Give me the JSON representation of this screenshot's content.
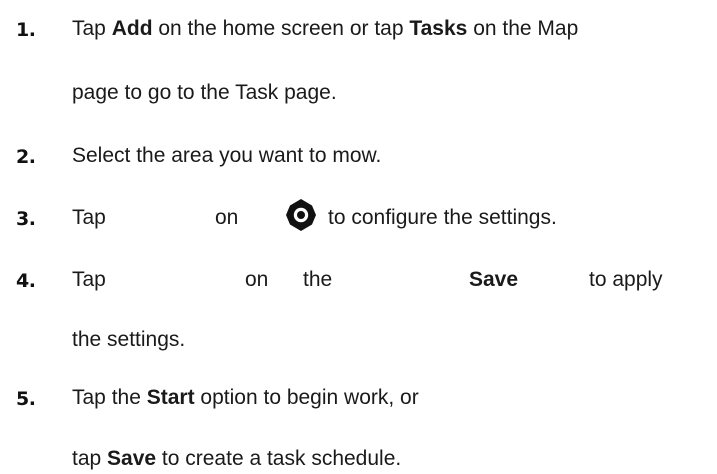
{
  "steps": [
    {
      "number": "1.",
      "line1": {
        "t1": "Tap ",
        "b1": "Add",
        "t2": " on the home screen or tap ",
        "b2": "Tasks",
        "t3": " on the Map"
      },
      "line2": "page to go to the Task page."
    },
    {
      "number": "2.",
      "line1": "Select the area you want to mow."
    },
    {
      "number": "3.",
      "tap": "Tap",
      "on": "on",
      "icon": "gear-icon",
      "rest": "to configure the settings."
    },
    {
      "number": "4.",
      "tap": "Tap",
      "on": "on",
      "the": "the",
      "save": "Save",
      "apply": "to apply",
      "line2": "the settings."
    },
    {
      "number": "5.",
      "line1": {
        "t1": "Tap the ",
        "b1": "Start",
        "t2": " option to begin work, or"
      },
      "line2": {
        "t1": "tap ",
        "b1": "Save",
        "t2": " to create a task schedule."
      }
    }
  ]
}
